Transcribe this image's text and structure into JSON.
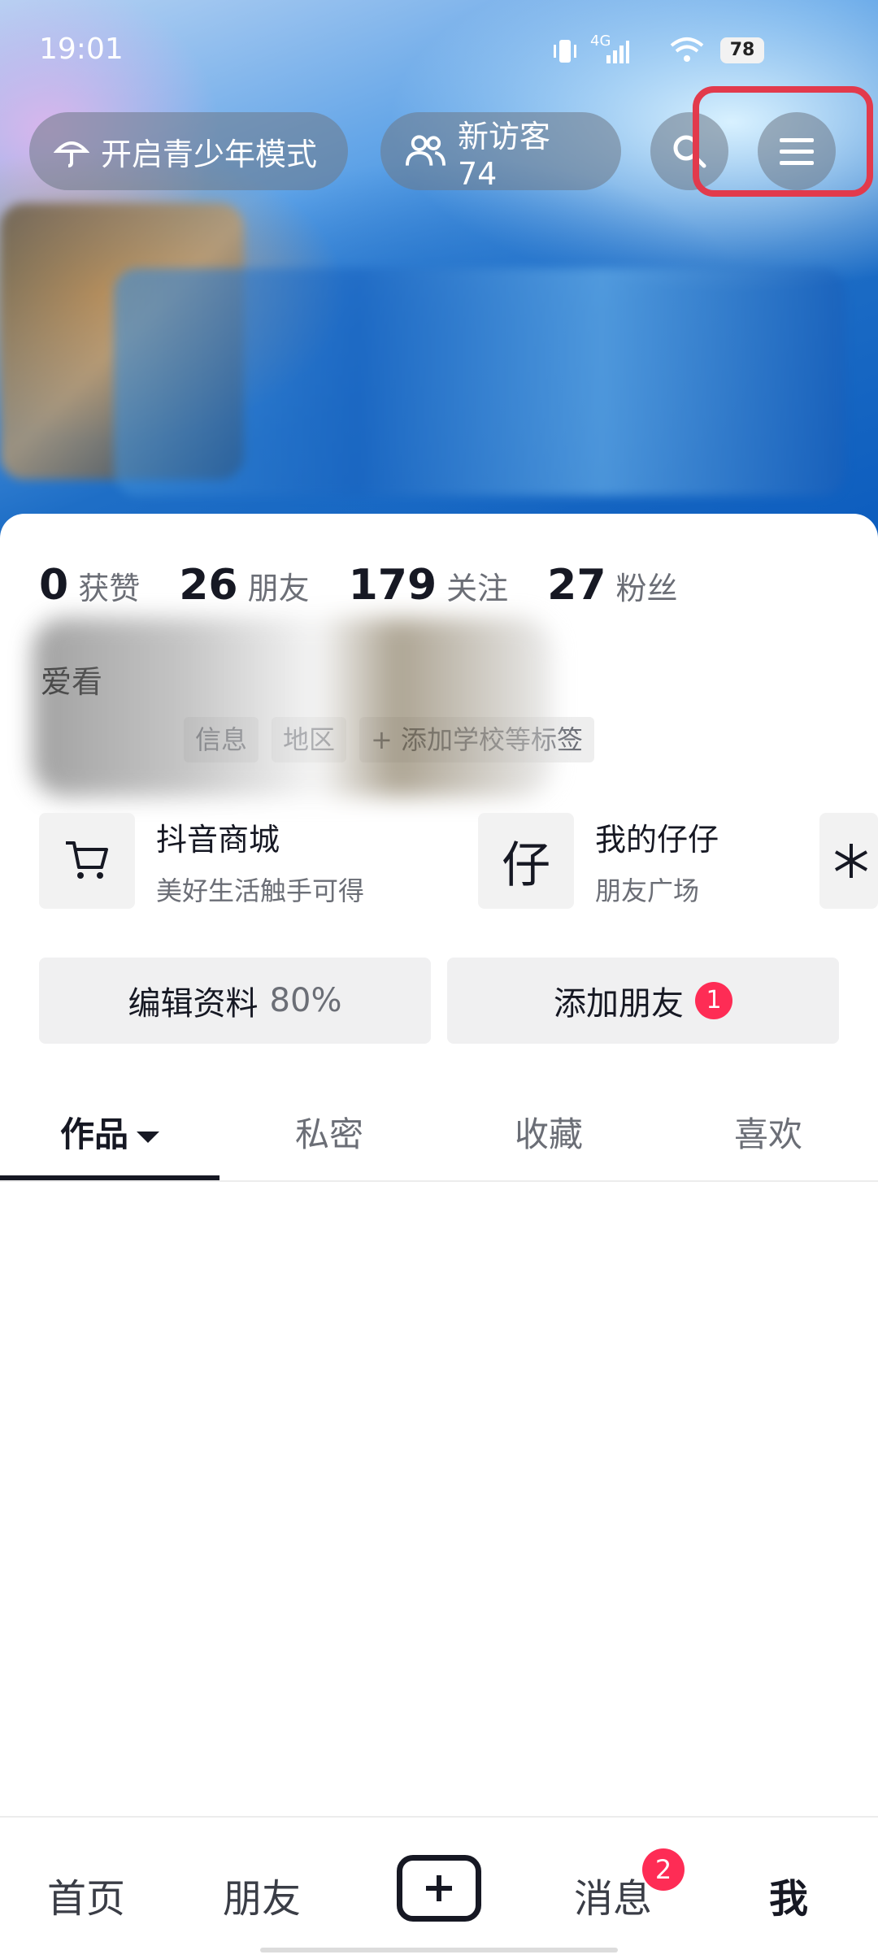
{
  "status_bar": {
    "time": "19:01",
    "signal": "4G",
    "battery": "78"
  },
  "header": {
    "teen_mode_label": "开启青少年模式",
    "visitors_label": "新访客 74"
  },
  "stats": [
    {
      "value": "0",
      "label": "获赞"
    },
    {
      "value": "26",
      "label": "朋友"
    },
    {
      "value": "179",
      "label": "关注"
    },
    {
      "value": "27",
      "label": "粉丝"
    }
  ],
  "profile": {
    "bio": "爱看",
    "tags": [
      "信息",
      "地区",
      "+ 添加学校等标签"
    ]
  },
  "services": [
    {
      "title": "抖音商城",
      "subtitle": "美好生活触手可得",
      "icon": "cart-icon"
    },
    {
      "title": "我的仔仔",
      "subtitle": "朋友广场",
      "icon": "zaizai-icon",
      "glyph": "仔"
    }
  ],
  "actions": {
    "edit_label": "编辑资料",
    "edit_percent": "80%",
    "add_friend_label": "添加朋友",
    "add_friend_badge": "1"
  },
  "tabs": [
    {
      "label": "作品",
      "active": true
    },
    {
      "label": "私密"
    },
    {
      "label": "收藏"
    },
    {
      "label": "喜欢"
    }
  ],
  "bottom_nav": {
    "home": "首页",
    "friends": "朋友",
    "messages": "消息",
    "messages_badge": "2",
    "me": "我"
  },
  "colors": {
    "accent": "#fe2c55",
    "highlight": "#e23a4c",
    "text": "#161823"
  }
}
